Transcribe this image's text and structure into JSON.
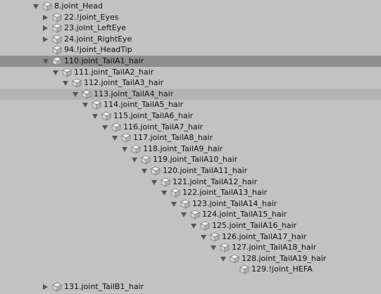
{
  "hierarchy": {
    "items": [
      {
        "label": "8.joint_Head",
        "depth": 0,
        "arrow": "down"
      },
      {
        "label": "22.!joint_Eyes",
        "depth": 1,
        "arrow": "right"
      },
      {
        "label": "23.joint_LeftEye",
        "depth": 1,
        "arrow": "right"
      },
      {
        "label": "24.joint_RightEye",
        "depth": 1,
        "arrow": "right"
      },
      {
        "label": "94.!joint_HeadTip",
        "depth": 1,
        "arrow": "none"
      },
      {
        "label": "110.joint_TailA1_hair",
        "depth": 1,
        "arrow": "down",
        "state": "selected"
      },
      {
        "label": "111.joint_TailA2_hair",
        "depth": 2,
        "arrow": "down"
      },
      {
        "label": "112.joint_TailA3_hair",
        "depth": 3,
        "arrow": "down",
        "state": "pre"
      },
      {
        "label": "113.joint_TailA4_hair",
        "depth": 4,
        "arrow": "down",
        "state": "hover"
      },
      {
        "label": "114.joint_TailA5_hair",
        "depth": 5,
        "arrow": "down"
      },
      {
        "label": "115.joint_TailA6_hair",
        "depth": 6,
        "arrow": "down"
      },
      {
        "label": "116.joint_TailA7_hair",
        "depth": 7,
        "arrow": "down"
      },
      {
        "label": "117.joint_TailA8_hair",
        "depth": 8,
        "arrow": "down"
      },
      {
        "label": "118.joint_TailA9_hair",
        "depth": 9,
        "arrow": "down"
      },
      {
        "label": "119.joint_TailA10_hair",
        "depth": 10,
        "arrow": "down"
      },
      {
        "label": "120.joint_TailA11_hair",
        "depth": 11,
        "arrow": "down"
      },
      {
        "label": "121.joint_TailA12_hair",
        "depth": 12,
        "arrow": "down"
      },
      {
        "label": "122.joint_TailA13_hair",
        "depth": 13,
        "arrow": "down"
      },
      {
        "label": "123.joint_TailA14_hair",
        "depth": 14,
        "arrow": "down"
      },
      {
        "label": "124.joint_TailA15_hair",
        "depth": 15,
        "arrow": "down"
      },
      {
        "label": "125.joint_TailA16_hair",
        "depth": 16,
        "arrow": "down"
      },
      {
        "label": "126.joint_TailA17_hair",
        "depth": 17,
        "arrow": "down"
      },
      {
        "label": "127.joint_TailA18_hair",
        "depth": 18,
        "arrow": "down"
      },
      {
        "label": "128.joint_TailA19_hair",
        "depth": 19,
        "arrow": "down"
      },
      {
        "label": "129.!joint_HEFA",
        "depth": 20,
        "arrow": "none"
      },
      {
        "label": "131.joint_TailB1_hair",
        "depth": 1,
        "arrow": "right",
        "state": "partial"
      }
    ]
  },
  "colors": {
    "background": "#c2c2c2",
    "selected_row": "#8f8f8f",
    "hover_row": "#b4b4b4"
  },
  "icons": {
    "node": "gameobject-cube-icon",
    "expand": "chevron-down-icon",
    "collapse": "chevron-right-icon"
  }
}
